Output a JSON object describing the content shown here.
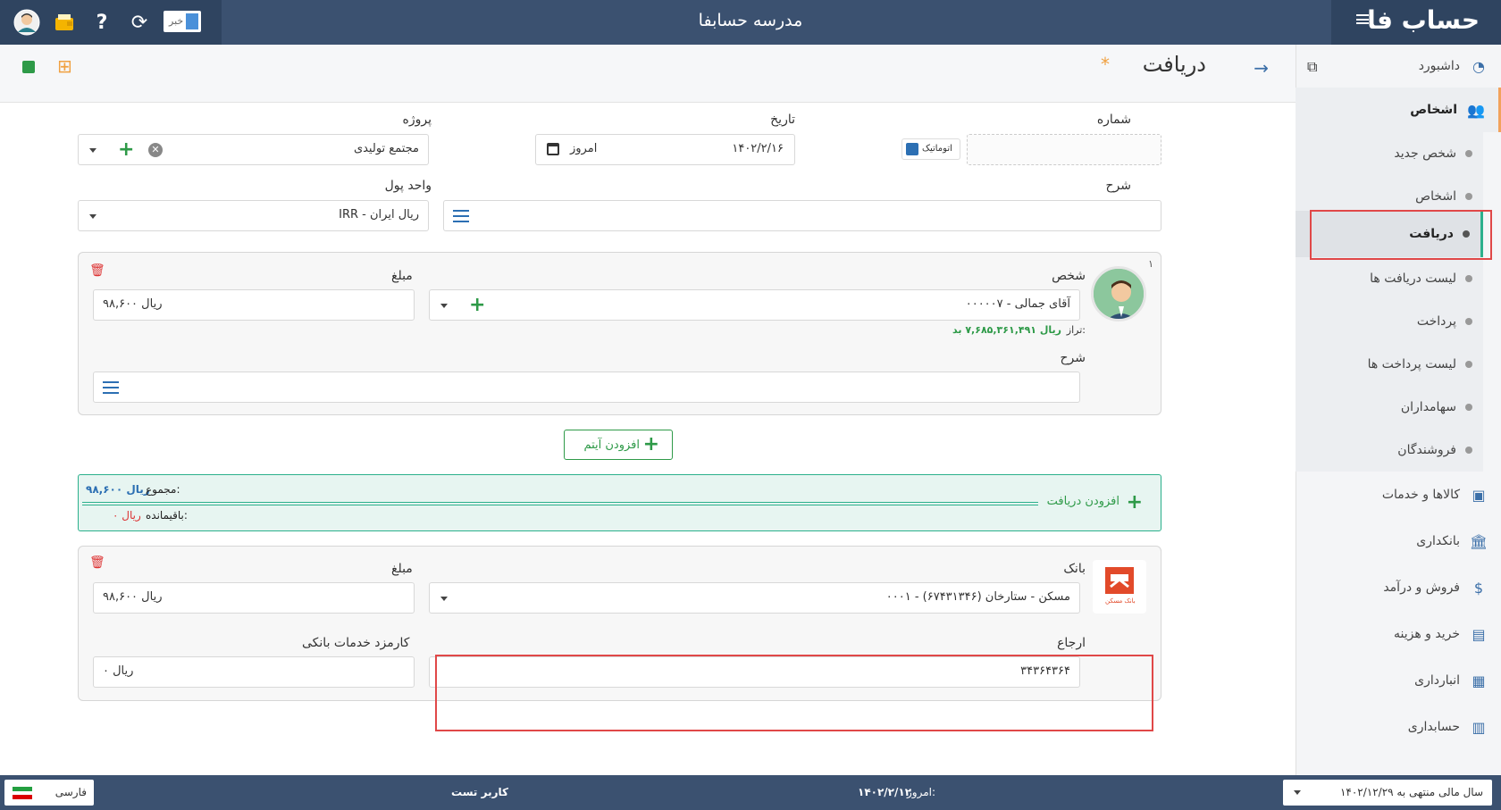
{
  "app": {
    "title": "مدرسه حسابفا",
    "logo": "حساب فا",
    "notif_label": "خبر"
  },
  "sidebar": {
    "dashboard": "داشبورد",
    "persons_header": "اشخاص",
    "sub_items": [
      {
        "label": "شخص جدید"
      },
      {
        "label": "اشخاص"
      },
      {
        "label": "دریافت"
      },
      {
        "label": "لیست دریافت ها"
      },
      {
        "label": "پرداخت"
      },
      {
        "label": "لیست پرداخت ها"
      },
      {
        "label": "سهامداران"
      },
      {
        "label": "فروشندگان"
      }
    ],
    "sections": [
      {
        "label": "کالاها و خدمات",
        "icon": "box-icon"
      },
      {
        "label": "بانکداری",
        "icon": "bank-icon"
      },
      {
        "label": "فروش و درآمد",
        "icon": "sales-icon"
      },
      {
        "label": "خرید و هزینه",
        "icon": "wallet-icon"
      },
      {
        "label": "انبارداری",
        "icon": "warehouse-icon"
      },
      {
        "label": "حسابداری",
        "icon": "ledger-icon"
      }
    ]
  },
  "page": {
    "title": "دریافت",
    "modified_mark": "*"
  },
  "form": {
    "number_label": "شماره",
    "auto_label": "اتوماتیک",
    "date_label": "تاریخ",
    "date_value": "۱۴۰۲/۲/۱۶",
    "today_label": "امروز",
    "project_label": "پروژه",
    "project_value": "مجتمع تولیدی",
    "desc_label": "شرح",
    "currency_label": "واحد پول",
    "currency_value": "IRR - ریال ایران"
  },
  "item": {
    "index": "۱",
    "person_label": "شخص",
    "person_value": "۰۰۰۰۰۷ - آقای جمالی",
    "balance_label": "تراز:",
    "balance_value": "ریال ۷,۶۸۵,۳۶۱,۴۹۱ بد",
    "amount_label": "مبلغ",
    "amount_value": "ریال ۹۸,۶۰۰",
    "desc_label": "شرح"
  },
  "add_item_label": "افزودن آیتم",
  "summary": {
    "add_receipt_label": "افزودن دریافت",
    "total_label": "مجموع:",
    "total_value": "ریال ۹۸,۶۰۰",
    "remaining_label": "باقیمانده:",
    "remaining_value": "ریال ۰"
  },
  "bank": {
    "bank_label": "بانک",
    "bank_logo_caption": "بانک مسکن",
    "bank_value": "۰۰۰۱ - مسکن - ستارخان (۶۷۴۳۱۳۴۶)",
    "amount_label": "مبلغ",
    "amount_value": "ریال ۹۸,۶۰۰",
    "ref_label": "ارجاع",
    "ref_value": "۳۴۳۶۴۳۶۴",
    "fee_label": "کارمزد خدمات بانکی",
    "fee_value": "ریال ۰"
  },
  "footer": {
    "fiscal_year": "سال مالی منتهی به ۱۴۰۲/۱۲/۲۹",
    "today_label": "امروز:",
    "today_value": "۱۴۰۲/۲/۱۲",
    "user": "کاربر تست",
    "language": "فارسی"
  },
  "colors": {
    "topbar": "#3b5170",
    "accent_green": "#2e9a48",
    "accent_blue": "#2c6fb3",
    "highlight_red": "#e04848"
  }
}
